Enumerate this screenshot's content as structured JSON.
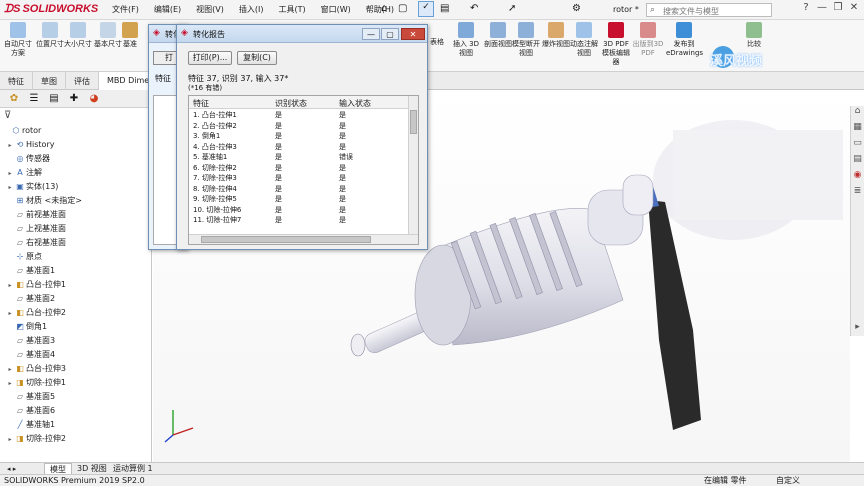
{
  "app": {
    "brand": "SOLIDWORKS",
    "menu": [
      "文件(F)",
      "编辑(E)",
      "视图(V)",
      "插入(I)",
      "工具(T)",
      "窗口(W)",
      "帮助(H)"
    ],
    "doc_title": "rotor *",
    "search_placeholder": "搜索文件与模型",
    "win_controls": [
      "?",
      "—",
      "❐",
      "✕"
    ]
  },
  "ribbon": {
    "left_buttons": [
      "自动尺寸方案",
      "位置尺寸",
      "大小尺寸",
      "基本尺寸",
      "基准"
    ],
    "right_buttons": [
      "表格",
      "插入 3D视图",
      "剖面视图",
      "模型断开视图",
      "爆炸视图",
      "动态注解视图",
      "3D PDF模板编辑器",
      "出版到3D PDF",
      "发布到eDrawings",
      "比较"
    ],
    "watermark": "溪风视频"
  },
  "command_tabs": [
    "特征",
    "草图",
    "评估",
    "MBD Dime"
  ],
  "tree": {
    "items": [
      {
        "label": "rotor",
        "icon": "part-icon",
        "depth": 0,
        "expand": ""
      },
      {
        "label": "History",
        "icon": "history-icon",
        "depth": 1,
        "expand": "▸"
      },
      {
        "label": "传感器",
        "icon": "sensor-icon",
        "depth": 1,
        "expand": ""
      },
      {
        "label": "注解",
        "icon": "annotation-icon",
        "depth": 1,
        "expand": "▸"
      },
      {
        "label": "实体(13)",
        "icon": "solid-bodies-icon",
        "depth": 1,
        "expand": "▸"
      },
      {
        "label": "材质 <未指定>",
        "icon": "material-icon",
        "depth": 1,
        "expand": ""
      },
      {
        "label": "前视基准面",
        "icon": "plane-icon",
        "depth": 1,
        "expand": ""
      },
      {
        "label": "上视基准面",
        "icon": "plane-icon",
        "depth": 1,
        "expand": ""
      },
      {
        "label": "右视基准面",
        "icon": "plane-icon",
        "depth": 1,
        "expand": ""
      },
      {
        "label": "原点",
        "icon": "origin-icon",
        "depth": 1,
        "expand": ""
      },
      {
        "label": "基准面1",
        "icon": "plane-icon",
        "depth": 1,
        "expand": ""
      },
      {
        "label": "凸台-拉伸1",
        "icon": "extrude-icon",
        "depth": 1,
        "expand": "▸"
      },
      {
        "label": "基准面2",
        "icon": "plane-icon",
        "depth": 1,
        "expand": ""
      },
      {
        "label": "凸台-拉伸2",
        "icon": "extrude-icon",
        "depth": 1,
        "expand": "▸"
      },
      {
        "label": "倒角1",
        "icon": "chamfer-icon",
        "depth": 1,
        "expand": ""
      },
      {
        "label": "基准面3",
        "icon": "plane-icon",
        "depth": 1,
        "expand": ""
      },
      {
        "label": "基准面4",
        "icon": "plane-icon",
        "depth": 1,
        "expand": ""
      },
      {
        "label": "凸台-拉伸3",
        "icon": "extrude-icon",
        "depth": 1,
        "expand": "▸"
      },
      {
        "label": "切除-拉伸1",
        "icon": "cut-icon",
        "depth": 1,
        "expand": "▸"
      },
      {
        "label": "基准面5",
        "icon": "plane-icon",
        "depth": 1,
        "expand": ""
      },
      {
        "label": "基准面6",
        "icon": "plane-icon",
        "depth": 1,
        "expand": ""
      },
      {
        "label": "基准轴1",
        "icon": "axis-icon",
        "depth": 1,
        "expand": ""
      },
      {
        "label": "切除-拉伸2",
        "icon": "cut-icon",
        "depth": 1,
        "expand": "▸"
      }
    ]
  },
  "dialog": {
    "title": "转化报告",
    "back_title": "转化",
    "print_label": "打印(P)...",
    "copy_label": "复制(C)",
    "back_button": "打",
    "summary_line1": "特征 37, 识别 37, 输入 37*",
    "summary_line2": "(*16 有错)",
    "back_summary": "特征",
    "columns": [
      "特征",
      "识别状态",
      "输入状态"
    ],
    "rows": [
      [
        "1. 凸台-拉伸1",
        "是",
        "是"
      ],
      [
        "2. 凸台-拉伸2",
        "是",
        "是"
      ],
      [
        "3. 倒角1",
        "是",
        "是"
      ],
      [
        "4. 凸台-拉伸3",
        "是",
        "是"
      ],
      [
        "5. 基准轴1",
        "是",
        "错误"
      ],
      [
        "6. 切除-拉伸2",
        "是",
        "是"
      ],
      [
        "7. 切除-拉伸3",
        "是",
        "是"
      ],
      [
        "8. 切除-拉伸4",
        "是",
        "是"
      ],
      [
        "9. 切除-拉伸5",
        "是",
        "是"
      ],
      [
        "10. 切除-拉伸6",
        "是",
        "是"
      ],
      [
        "11. 切除-拉伸7",
        "是",
        "是"
      ]
    ]
  },
  "bottom_tabs": [
    "模型",
    "3D 视图",
    "运动算例 1"
  ],
  "status": {
    "version": "SOLIDWORKS Premium 2019 SP2.0",
    "mode": "在编辑 零件",
    "units": "自定义"
  },
  "colors": {
    "brand": "#c8102e",
    "accent": "#1f6fc8",
    "model": "#e7e7ee",
    "model_shade": "#c9c9d6",
    "tool": "#2a2a2a"
  }
}
